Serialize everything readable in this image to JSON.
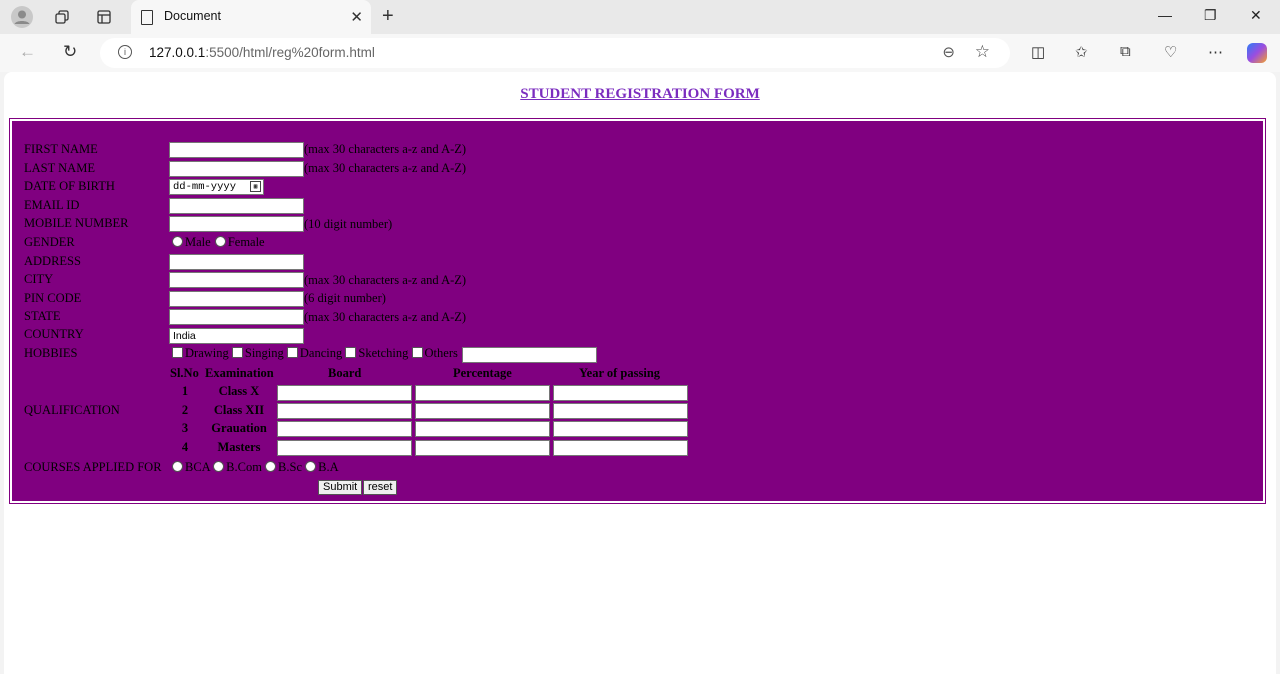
{
  "browser": {
    "tab_title": "Document",
    "url_host": "127.0.0.1",
    "url_port_path": ":5500/html/reg%20form.html"
  },
  "page": {
    "title": "STUDENT REGISTRATION FORM"
  },
  "form": {
    "first_name_label": "FIRST NAME",
    "first_name_note": "(max 30 characters a-z and A-Z)",
    "last_name_label": "LAST NAME",
    "last_name_note": "(max 30 characters a-z and A-Z)",
    "dob_label": "DATE OF BIRTH",
    "dob_placeholder": "dd-mm-yyyy",
    "email_label": "EMAIL ID",
    "mobile_label": "MOBILE NUMBER",
    "mobile_note": "(10 digit number)",
    "gender_label": "GENDER",
    "gender_male": "Male",
    "gender_female": "Female",
    "address_label": "ADDRESS",
    "city_label": "CITY",
    "city_note": "(max 30 characters a-z and A-Z)",
    "pin_label": "PIN CODE",
    "pin_note": "(6 digit number)",
    "state_label": "STATE",
    "state_note": "(max 30 characters a-z and A-Z)",
    "country_label": "COUNTRY",
    "country_value": "India",
    "hobbies_label": "HOBBIES",
    "hobbies": [
      "Drawing",
      "Singing",
      "Dancing",
      "Sketching",
      "Others"
    ],
    "qualification_label": "QUALIFICATION",
    "qual_headers": [
      "Sl.No",
      "Examination",
      "Board",
      "Percentage",
      "Year of passing"
    ],
    "qual_rows": [
      {
        "no": "1",
        "exam": "Class X"
      },
      {
        "no": "2",
        "exam": "Class XII"
      },
      {
        "no": "3",
        "exam": "Grauation"
      },
      {
        "no": "4",
        "exam": "Masters"
      }
    ],
    "courses_label": "COURSES APPLIED FOR",
    "courses": [
      "BCA",
      "B.Com",
      "B.Sc",
      "B.A"
    ],
    "submit_label": "Submit",
    "reset_label": "reset"
  }
}
